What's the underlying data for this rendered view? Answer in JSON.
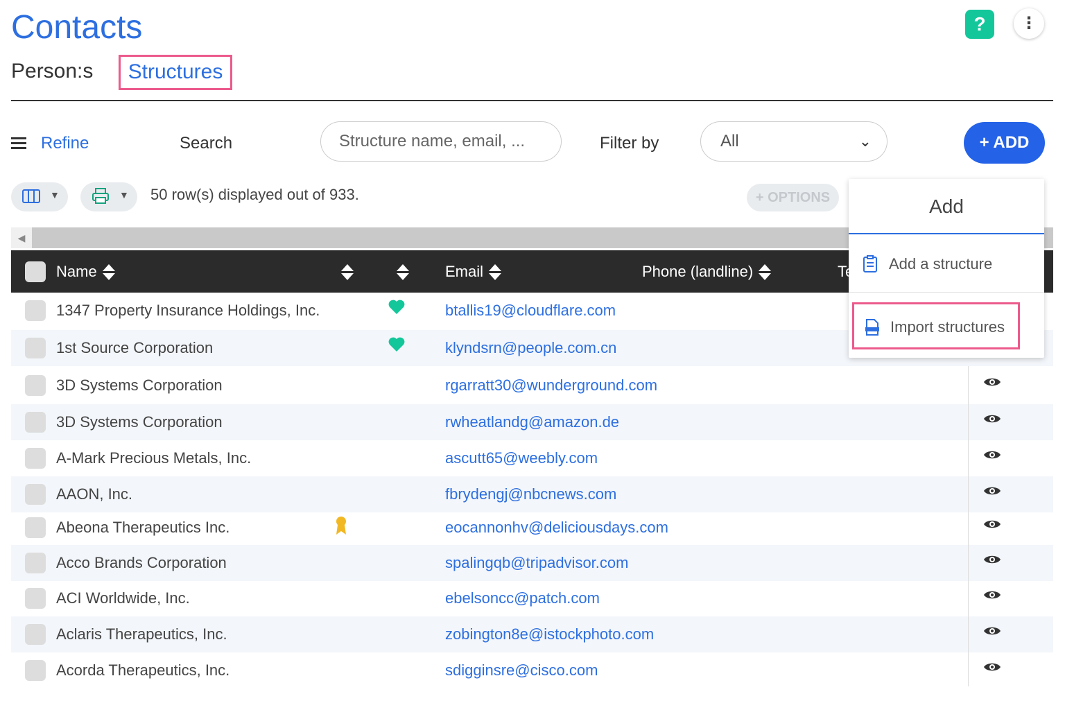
{
  "header": {
    "title": "Contacts",
    "help_label": "?",
    "menu_label": "⋮"
  },
  "tabs": [
    {
      "label": "Person:s",
      "active": false
    },
    {
      "label": "Structures",
      "active": true
    }
  ],
  "toolbar": {
    "refine_label": "Refine",
    "search_label": "Search",
    "search_placeholder": "Structure name, email, ...",
    "filter_label": "Filter by",
    "filter_value": "All",
    "add_label": "+ ADD",
    "rows_info": "50 row(s) displayed out of 933.",
    "options_label": "+ OPTIONS"
  },
  "table": {
    "columns": [
      "Name",
      "Email",
      "Phone (landline)",
      "Te"
    ],
    "rows": [
      {
        "name": "1347 Property Insurance Holdings, Inc.",
        "email": "btallis19@cloudflare.com",
        "favorite": true,
        "award": false,
        "eye": false
      },
      {
        "name": "1st Source Corporation",
        "email": "klyndsrn@people.com.cn",
        "favorite": true,
        "award": false,
        "eye": false
      },
      {
        "name": "3D Systems Corporation",
        "email": "rgarratt30@wunderground.com",
        "favorite": false,
        "award": false,
        "eye": true
      },
      {
        "name": "3D Systems Corporation",
        "email": "rwheatlandg@amazon.de",
        "favorite": false,
        "award": false,
        "eye": true
      },
      {
        "name": "A-Mark Precious Metals, Inc.",
        "email": "ascutt65@weebly.com",
        "favorite": false,
        "award": false,
        "eye": true
      },
      {
        "name": "AAON, Inc.",
        "email": "fbrydengj@nbcnews.com",
        "favorite": false,
        "award": false,
        "eye": true
      },
      {
        "name": "Abeona Therapeutics Inc.",
        "email": "eocannonhv@deliciousdays.com",
        "favorite": false,
        "award": true,
        "eye": true
      },
      {
        "name": "Acco Brands Corporation",
        "email": "spalingqb@tripadvisor.com",
        "favorite": false,
        "award": false,
        "eye": true
      },
      {
        "name": "ACI Worldwide, Inc.",
        "email": "ebelsoncc@patch.com",
        "favorite": false,
        "award": false,
        "eye": true
      },
      {
        "name": "Aclaris Therapeutics, Inc.",
        "email": "zobington8e@istockphoto.com",
        "favorite": false,
        "award": false,
        "eye": true
      },
      {
        "name": "Acorda Therapeutics, Inc.",
        "email": "sdigginsre@cisco.com",
        "favorite": false,
        "award": false,
        "eye": true
      }
    ]
  },
  "add_menu": {
    "title": "Add",
    "items": [
      {
        "label": "Add a structure",
        "icon": "clipboard-icon"
      },
      {
        "label": "Import structures",
        "icon": "import-file-icon"
      }
    ]
  },
  "colors": {
    "accent": "#2d6fe0",
    "highlight": "#ec5a8c",
    "favorite": "#14c79b",
    "award": "#f2b824"
  }
}
